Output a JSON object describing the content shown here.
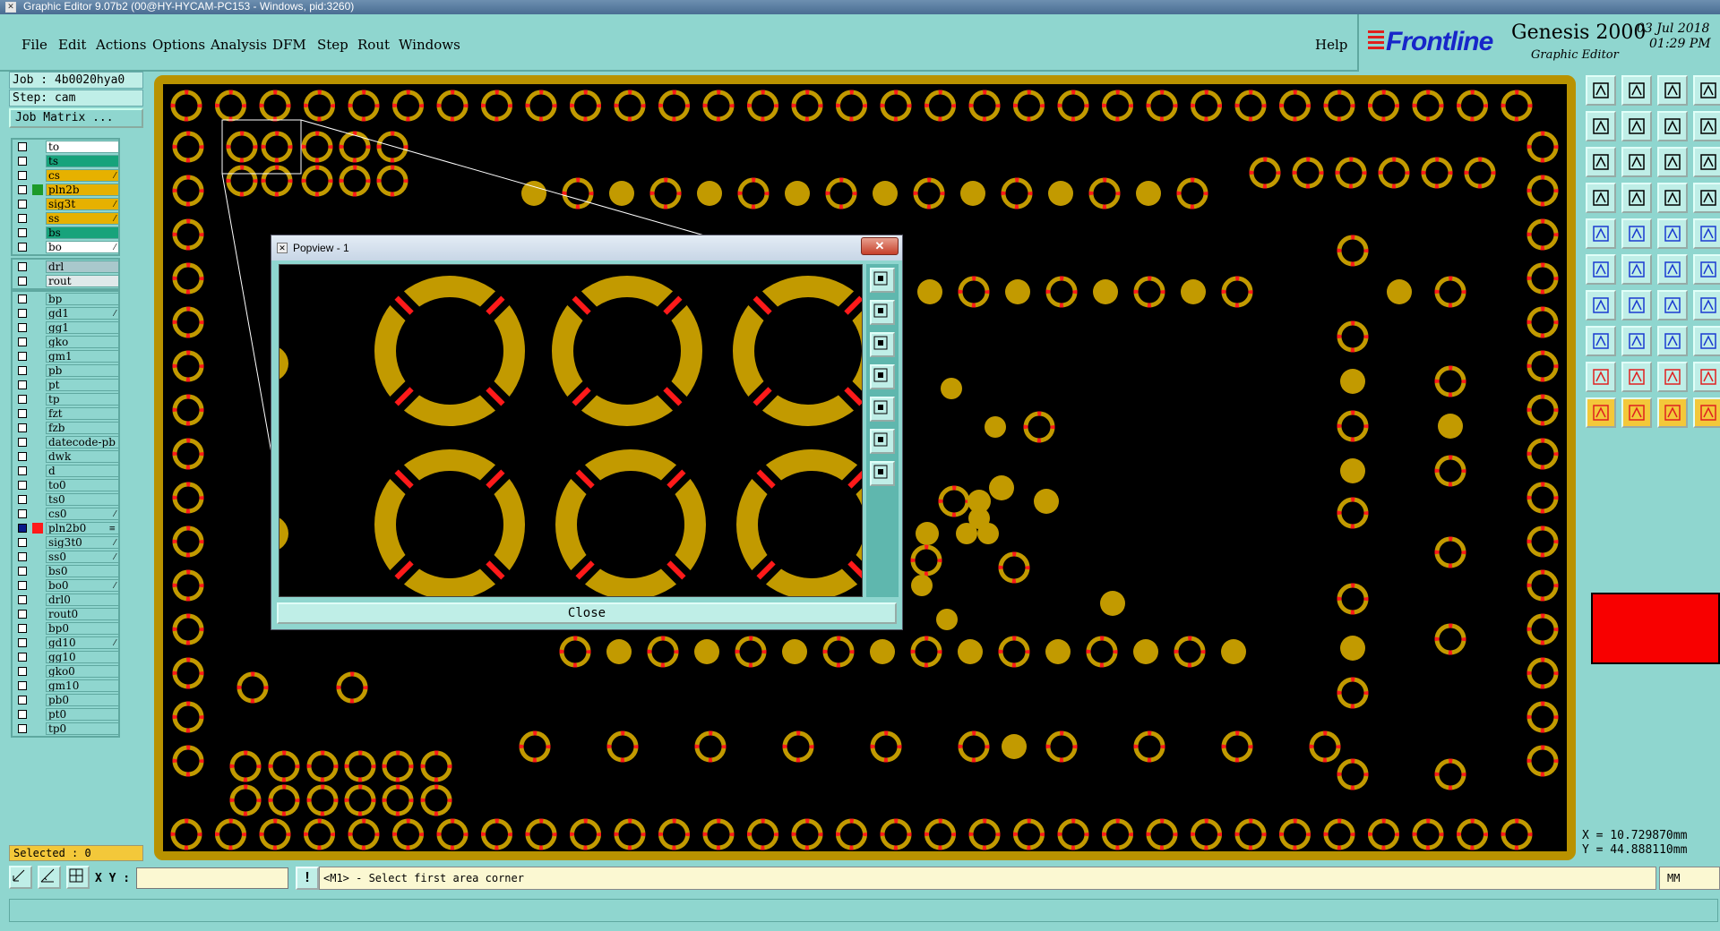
{
  "window": {
    "title": "Graphic Editor 9.07b2 (00@HY-HYCAM-PC153 - Windows, pid:3260)"
  },
  "menu": {
    "items": [
      {
        "label": "File"
      },
      {
        "label": "Edit"
      },
      {
        "label": "Actions"
      },
      {
        "label": "Options"
      },
      {
        "label": "Analysis"
      },
      {
        "label": "DFM"
      },
      {
        "label": "Step"
      },
      {
        "label": "Rout"
      },
      {
        "label": "Windows"
      }
    ],
    "help": "Help"
  },
  "branding": {
    "frontline": "Frontline",
    "product": "Genesis 2000",
    "subtitle": "Graphic Editor",
    "date": "03 Jul 2018",
    "time": "01:29 PM",
    "brand_color": "#1726c9"
  },
  "job": {
    "job_label": "Job : 4b0020hya0",
    "step_label": "Step: cam",
    "job_matrix": "Job Matrix ..."
  },
  "layers": {
    "group1": [
      {
        "name": "to",
        "color": "#ffffff",
        "swatch": "",
        "mark": ""
      },
      {
        "name": "ts",
        "color": "#17a37b",
        "swatch": "",
        "mark": ""
      },
      {
        "name": "cs",
        "color": "#e6b100",
        "swatch": "",
        "mark": "⁄"
      },
      {
        "name": "pln2b",
        "color": "#e6b100",
        "swatch": "#1d9a2a",
        "mark": ""
      },
      {
        "name": "sig3t",
        "color": "#e6b100",
        "swatch": "",
        "mark": "⁄"
      },
      {
        "name": "ss",
        "color": "#e6b100",
        "swatch": "",
        "mark": "⁄"
      },
      {
        "name": "bs",
        "color": "#17a37b",
        "swatch": "",
        "mark": ""
      },
      {
        "name": "bo",
        "color": "#ffffff",
        "swatch": "",
        "mark": "⁄"
      }
    ],
    "group2": [
      {
        "name": "drl",
        "color": "#a9c8cc",
        "swatch": "",
        "mark": ""
      },
      {
        "name": "rout",
        "color": "#dfe9ea",
        "swatch": "",
        "mark": ""
      }
    ],
    "group3": [
      {
        "name": "bp",
        "color": "#8fd6cf",
        "swatch": "",
        "mark": ""
      },
      {
        "name": "gd1",
        "color": "#8fd6cf",
        "swatch": "",
        "mark": "⁄"
      },
      {
        "name": "gg1",
        "color": "#8fd6cf",
        "swatch": "",
        "mark": ""
      },
      {
        "name": "gko",
        "color": "#8fd6cf",
        "swatch": "",
        "mark": ""
      },
      {
        "name": "gm1",
        "color": "#8fd6cf",
        "swatch": "",
        "mark": ""
      },
      {
        "name": "pb",
        "color": "#8fd6cf",
        "swatch": "",
        "mark": ""
      },
      {
        "name": "pt",
        "color": "#8fd6cf",
        "swatch": "",
        "mark": ""
      },
      {
        "name": "tp",
        "color": "#8fd6cf",
        "swatch": "",
        "mark": ""
      },
      {
        "name": "fzt",
        "color": "#8fd6cf",
        "swatch": "",
        "mark": ""
      },
      {
        "name": "fzb",
        "color": "#8fd6cf",
        "swatch": "",
        "mark": ""
      },
      {
        "name": "datecode-pb",
        "color": "#8fd6cf",
        "swatch": "",
        "mark": ""
      },
      {
        "name": "dwk",
        "color": "#8fd6cf",
        "swatch": "",
        "mark": ""
      },
      {
        "name": "d",
        "color": "#8fd6cf",
        "swatch": "",
        "mark": ""
      },
      {
        "name": "to0",
        "color": "#8fd6cf",
        "swatch": "",
        "mark": ""
      },
      {
        "name": "ts0",
        "color": "#8fd6cf",
        "swatch": "",
        "mark": ""
      },
      {
        "name": "cs0",
        "color": "#8fd6cf",
        "swatch": "",
        "mark": "⁄"
      },
      {
        "name": "pln2b0",
        "color": "#8fd6cf",
        "swatch": "#ff1a1a",
        "mark": "≡",
        "active": true
      },
      {
        "name": "sig3t0",
        "color": "#8fd6cf",
        "swatch": "",
        "mark": "⁄"
      },
      {
        "name": "ss0",
        "color": "#8fd6cf",
        "swatch": "",
        "mark": "⁄"
      },
      {
        "name": "bs0",
        "color": "#8fd6cf",
        "swatch": "",
        "mark": ""
      },
      {
        "name": "bo0",
        "color": "#8fd6cf",
        "swatch": "",
        "mark": "⁄"
      },
      {
        "name": "drl0",
        "color": "#8fd6cf",
        "swatch": "",
        "mark": ""
      },
      {
        "name": "rout0",
        "color": "#8fd6cf",
        "swatch": "",
        "mark": ""
      },
      {
        "name": "bp0",
        "color": "#8fd6cf",
        "swatch": "",
        "mark": ""
      },
      {
        "name": "gd10",
        "color": "#8fd6cf",
        "swatch": "",
        "mark": "⁄"
      },
      {
        "name": "gg10",
        "color": "#8fd6cf",
        "swatch": "",
        "mark": ""
      },
      {
        "name": "gko0",
        "color": "#8fd6cf",
        "swatch": "",
        "mark": ""
      },
      {
        "name": "gm10",
        "color": "#8fd6cf",
        "swatch": "",
        "mark": ""
      },
      {
        "name": "pb0",
        "color": "#8fd6cf",
        "swatch": "",
        "mark": ""
      },
      {
        "name": "pt0",
        "color": "#8fd6cf",
        "swatch": "",
        "mark": ""
      },
      {
        "name": "tp0",
        "color": "#8fd6cf",
        "swatch": "",
        "mark": ""
      }
    ]
  },
  "selected": "Selected : 0",
  "colors": {
    "pad": "#c29a00",
    "relief": "#ff1a1a",
    "board_border": "#b99200",
    "canvas_bg": "#000000"
  },
  "popview": {
    "title": "Popview - 1",
    "close_label": "Close",
    "close_x": "✕"
  },
  "coords": {
    "x": "X = 10.729870mm",
    "y": "Y = 44.888110mm"
  },
  "statusbar": {
    "xy_label": "X Y :",
    "xy_value": "",
    "excl": "!",
    "prompt": "<M1> - Select first area corner",
    "units": "MM"
  }
}
